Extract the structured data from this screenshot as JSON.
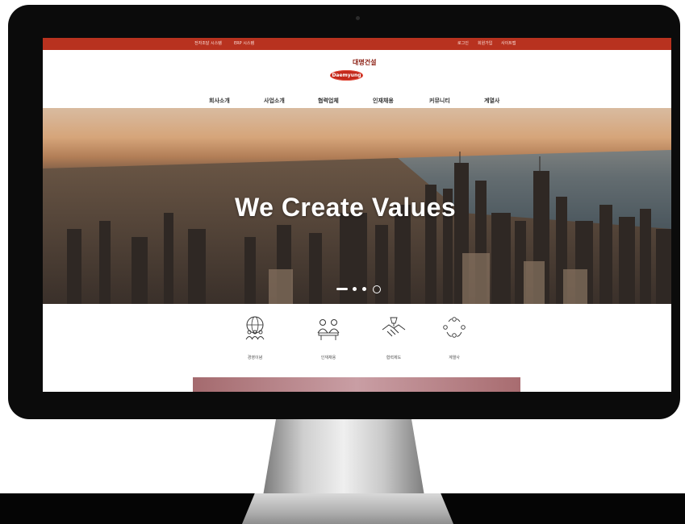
{
  "topbar": {
    "left_links": [
      "전자조달 시스템",
      "ERP 시스템"
    ],
    "right_links": [
      "로그인",
      "회원가입",
      "사이트맵"
    ]
  },
  "logo": {
    "company_name": "대명건설",
    "badge_text": "Daemyung"
  },
  "nav": {
    "items": [
      "회사소개",
      "사업소개",
      "협력업체",
      "인재채용",
      "커뮤니티",
      "계열사"
    ]
  },
  "hero": {
    "title": "We Create Values",
    "slide_count": 3,
    "active_slide": 1
  },
  "services": [
    {
      "label": "경영이념",
      "icon": "globe-people-icon"
    },
    {
      "label": "인재채용",
      "icon": "interview-icon"
    },
    {
      "label": "협력제도",
      "icon": "handshake-icon"
    },
    {
      "label": "계열사",
      "icon": "network-people-icon"
    }
  ],
  "colors": {
    "topbar": "#b8321f",
    "brand": "#c3281a"
  }
}
